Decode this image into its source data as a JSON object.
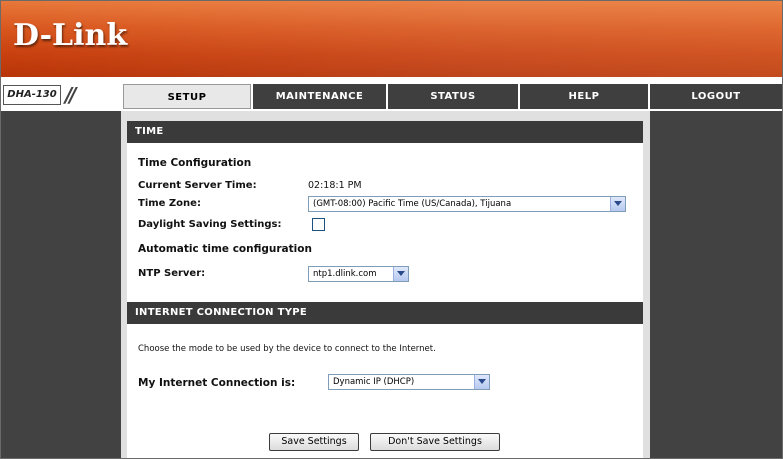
{
  "brand": {
    "logo_text": "D-Link",
    "model": "DHA-130"
  },
  "nav": {
    "tabs": [
      {
        "label": "SETUP",
        "active": true
      },
      {
        "label": "MAINTENANCE",
        "active": false
      },
      {
        "label": "STATUS",
        "active": false
      },
      {
        "label": "HELP",
        "active": false
      },
      {
        "label": "LOGOUT",
        "active": false
      }
    ]
  },
  "time_section": {
    "header": "TIME",
    "config_title": "Time Configuration",
    "current_server_time_label": "Current Server Time:",
    "current_server_time_value": "02:18:1 PM",
    "time_zone_label": "Time Zone:",
    "time_zone_value": "(GMT-08:00) Pacific Time (US/Canada), Tijuana",
    "dst_label": "Daylight Saving Settings:",
    "dst_checked": false,
    "auto_title": "Automatic time configuration",
    "ntp_label": "NTP Server:",
    "ntp_value": "ntp1.dlink.com"
  },
  "connection_section": {
    "header": "INTERNET CONNECTION TYPE",
    "description": "Choose the mode to be used by the device to connect to the Internet.",
    "connection_label": "My Internet Connection is:",
    "connection_value": "Dynamic IP (DHCP)"
  },
  "actions": {
    "save_label": "Save Settings",
    "dont_save_label": "Don't Save Settings"
  },
  "colors": {
    "header_orange": "#d9581f",
    "nav_dark": "#3f3f3f",
    "side_panel": "#424242",
    "section_header": "#3a3a3a"
  }
}
